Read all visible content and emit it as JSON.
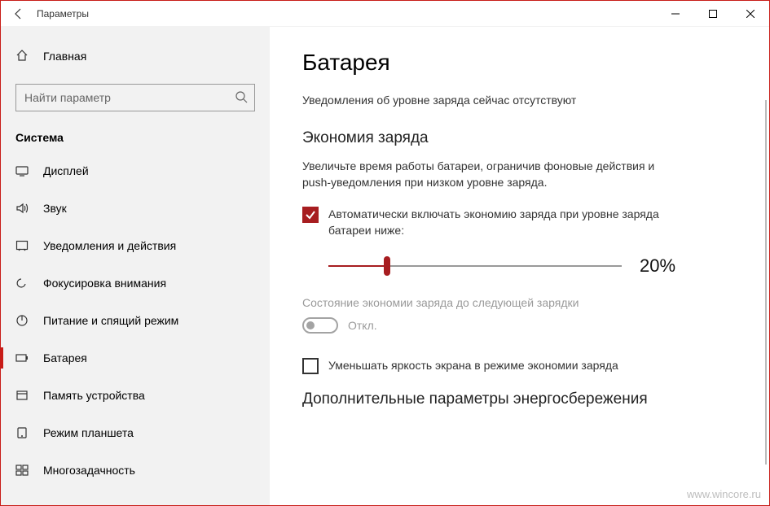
{
  "titlebar": {
    "title": "Параметры"
  },
  "sidebar": {
    "home": "Главная",
    "search_placeholder": "Найти параметр",
    "group": "Система",
    "items": [
      {
        "label": "Дисплей"
      },
      {
        "label": "Звук"
      },
      {
        "label": "Уведомления и действия"
      },
      {
        "label": "Фокусировка внимания"
      },
      {
        "label": "Питание и спящий режим"
      },
      {
        "label": "Батарея"
      },
      {
        "label": "Память устройства"
      },
      {
        "label": "Режим планшета"
      },
      {
        "label": "Многозадачность"
      }
    ],
    "active_index": 5
  },
  "main": {
    "title": "Батарея",
    "notice": "Уведомления об уровне заряда сейчас отсутствуют",
    "saver_header": "Экономия заряда",
    "saver_desc": "Увеличьте время работы батареи, ограничив фоновые действия и push-уведомления при низком уровне заряда.",
    "auto_enable_label": "Автоматически включать экономию заряда при уровне заряда батареи ниже:",
    "auto_enable_checked": true,
    "slider_percent": 20,
    "slider_value_display": "20%",
    "until_next_charge_label": "Состояние экономии заряда до следующей зарядки",
    "toggle_state": "Откл.",
    "toggle_on": false,
    "dim_label": "Уменьшать яркость экрана в режиме экономии заряда",
    "dim_checked": false,
    "more_header": "Дополнительные параметры энергосбережения"
  },
  "watermark": "www.wincore.ru"
}
